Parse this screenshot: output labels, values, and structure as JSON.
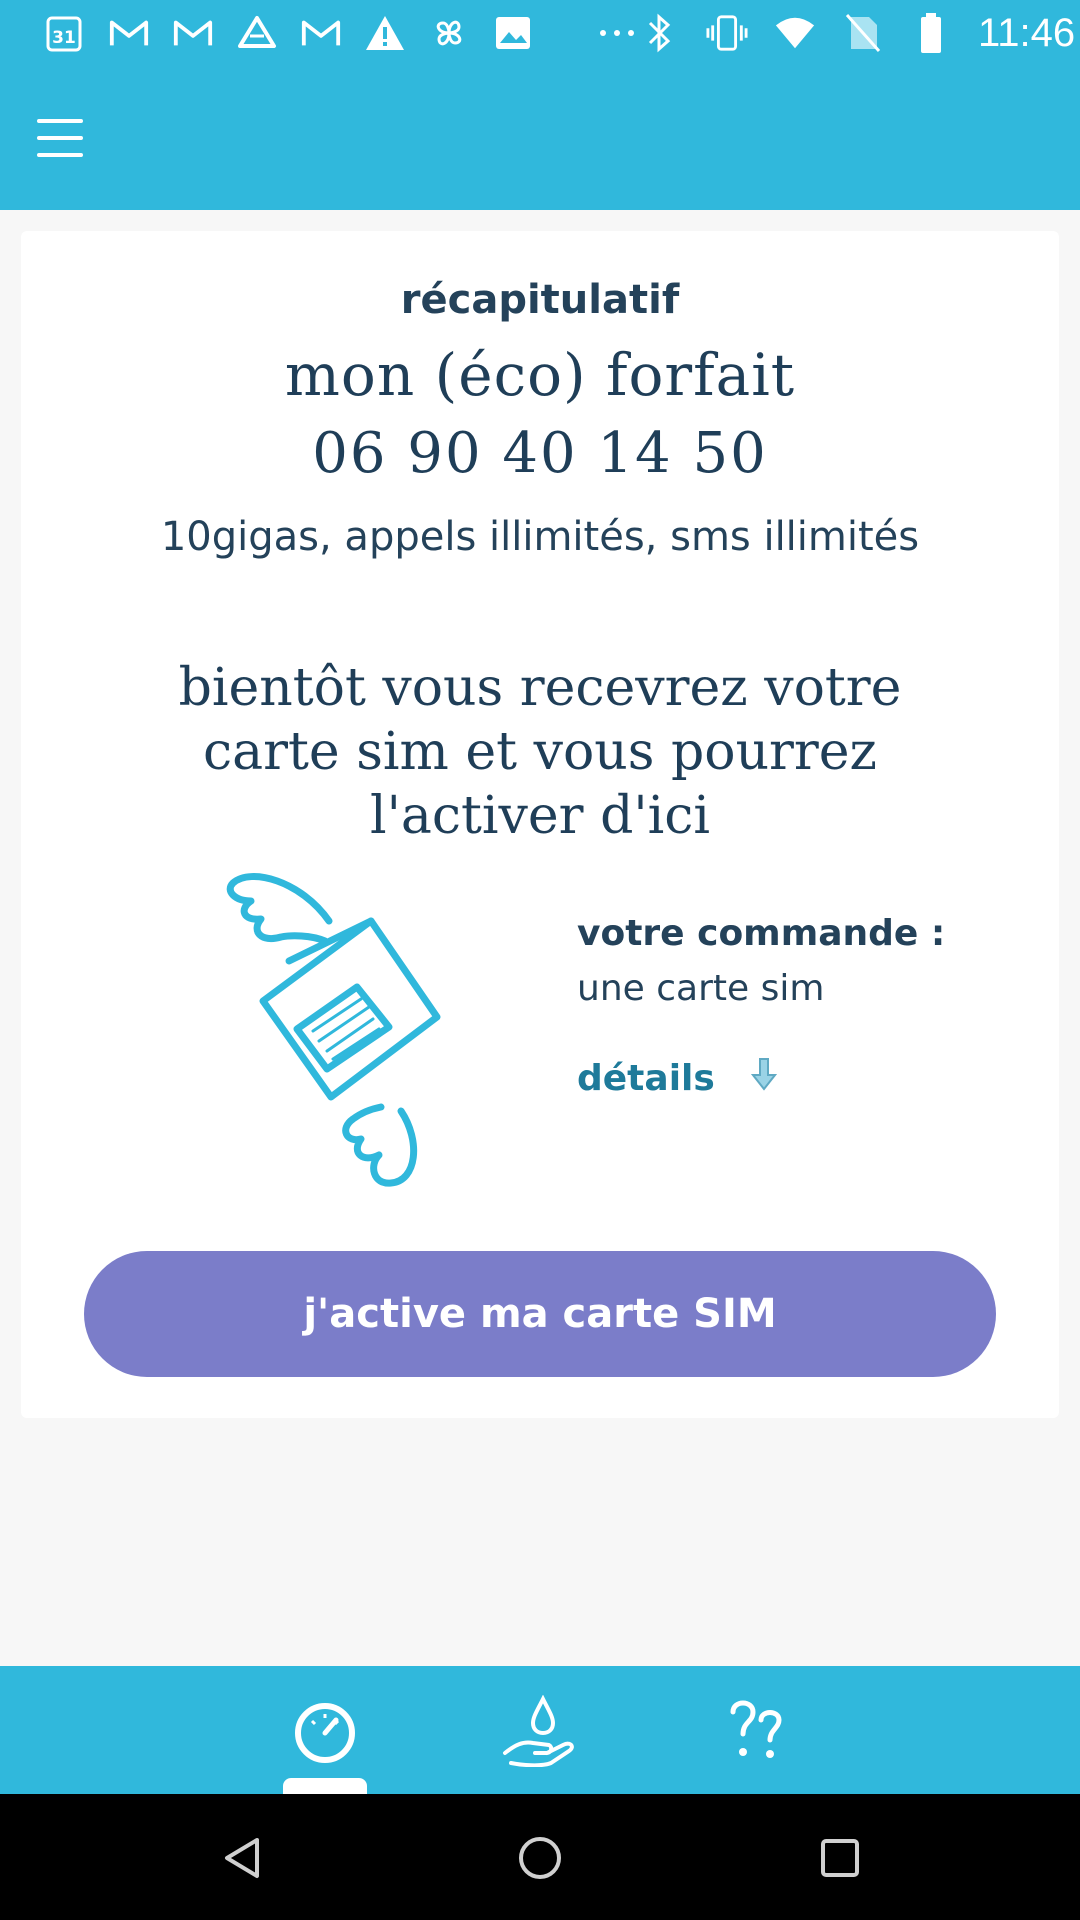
{
  "status_bar": {
    "time": "11:46",
    "calendar_day": "31",
    "left_icons": [
      "calendar-icon",
      "gmail-icon",
      "gmail-icon",
      "drive-icon",
      "gmail-icon",
      "warning-icon",
      "pinwheel-icon",
      "image-icon",
      "more-icon"
    ],
    "right_icons": [
      "bluetooth-icon",
      "vibrate-icon",
      "wifi-icon",
      "no-sim-icon",
      "battery-icon"
    ]
  },
  "app_bar": {
    "menu_icon": "hamburger-menu-icon"
  },
  "summary": {
    "heading": "récapitulatif",
    "plan_name": "mon (éco) forfait",
    "phone_number": "06 90 40 14 50",
    "features": "10gigas, appels illimités, sms illimités"
  },
  "notice": "bientôt vous recevrez votre carte sim et vous pourrez l'activer d'ici",
  "order": {
    "title": "votre commande :",
    "value": "une carte sim",
    "details_link": "détails",
    "details_icon": "arrow-down-icon"
  },
  "cta": {
    "label": "j'active ma carte SIM"
  },
  "bottom_nav": {
    "items": [
      {
        "icon": "speedometer-icon",
        "active": true
      },
      {
        "icon": "hand-drop-icon",
        "active": false
      },
      {
        "icon": "question-marks-icon",
        "active": false
      }
    ]
  },
  "system_nav": [
    "back-icon",
    "home-icon",
    "recents-icon"
  ],
  "colors": {
    "primary": "#30b8dc",
    "text_dark": "#24425a",
    "cta": "#7b7dc9",
    "link": "#1e7a9a",
    "background": "#f7f7f7"
  }
}
